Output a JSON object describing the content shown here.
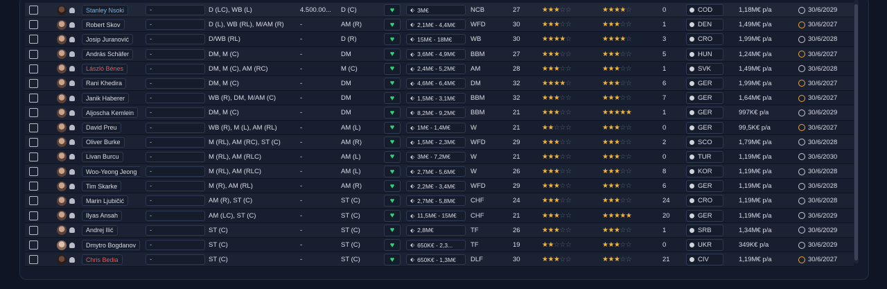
{
  "rows": [
    {
      "name": "Stanley Nsoki",
      "name_style": "link",
      "select": "-",
      "positions": "D (LC), WB (L)",
      "fee": "4.500.00...",
      "role": "D (C)",
      "value": "3M€",
      "rating_pos": "NCB",
      "age": "27",
      "ability_stars": 3,
      "ability_half": false,
      "potential_stars": 3,
      "potential_half": true,
      "count": "0",
      "nation": "COD",
      "wage": "1,18M€ p/a",
      "expiry": "30/6/2029",
      "expiry_warn": false
    },
    {
      "name": "Robert Skov",
      "name_style": "",
      "select": "-",
      "positions": "D (L), WB (RL), M/AM (R)",
      "fee": "-",
      "role": "AM (R)",
      "value": "2,1M€ - 4,4M€",
      "rating_pos": "WFD",
      "age": "30",
      "ability_stars": 2,
      "ability_half": true,
      "potential_stars": 2,
      "potential_half": true,
      "count": "1",
      "nation": "DEN",
      "wage": "1,49M€ p/a",
      "expiry": "30/6/2027",
      "expiry_warn": true
    },
    {
      "name": "Josip Juranović",
      "name_style": "",
      "select": "-",
      "positions": "D/WB (RL)",
      "fee": "-",
      "role": "D (R)",
      "value": "15M€ - 18M€",
      "rating_pos": "WB",
      "age": "30",
      "ability_stars": 3,
      "ability_half": true,
      "potential_stars": 3,
      "potential_half": true,
      "count": "3",
      "nation": "CRO",
      "wage": "1,99M€ p/a",
      "expiry": "30/6/2028",
      "expiry_warn": false
    },
    {
      "name": "András Schäfer",
      "name_style": "",
      "select": "-",
      "positions": "DM, M (C)",
      "fee": "-",
      "role": "DM",
      "value": "3,6M€ - 4,9M€",
      "rating_pos": "BBM",
      "age": "27",
      "ability_stars": 3,
      "ability_half": false,
      "potential_stars": 3,
      "potential_half": false,
      "count": "5",
      "nation": "HUN",
      "wage": "1,24M€ p/a",
      "expiry": "30/6/2027",
      "expiry_warn": true
    },
    {
      "name": "László Bénes",
      "name_style": "red",
      "select": "-",
      "positions": "DM, M (C), AM (RC)",
      "fee": "-",
      "role": "M (C)",
      "value": "2,4M€ - 5,2M€",
      "rating_pos": "AM",
      "age": "28",
      "ability_stars": 3,
      "ability_half": false,
      "potential_stars": 3,
      "potential_half": false,
      "count": "1",
      "nation": "SVK",
      "wage": "1,49M€ p/a",
      "expiry": "30/6/2028",
      "expiry_warn": false
    },
    {
      "name": "Rani Khedira",
      "name_style": "",
      "select": "-",
      "positions": "DM, M (C)",
      "fee": "-",
      "role": "DM",
      "value": "4,6M€ - 6,4M€",
      "rating_pos": "DM",
      "age": "32",
      "ability_stars": 3,
      "ability_half": true,
      "potential_stars": 3,
      "potential_half": false,
      "count": "6",
      "nation": "GER",
      "wage": "1,99M€ p/a",
      "expiry": "30/6/2027",
      "expiry_warn": true
    },
    {
      "name": "Janik Haberer",
      "name_style": "",
      "select": "-",
      "positions": "WB (R), DM, M/AM (C)",
      "fee": "-",
      "role": "DM",
      "value": "1,5M€ - 3,1M€",
      "rating_pos": "BBM",
      "age": "32",
      "ability_stars": 3,
      "ability_half": false,
      "potential_stars": 3,
      "potential_half": false,
      "count": "7",
      "nation": "GER",
      "wage": "1,64M€ p/a",
      "expiry": "30/6/2027",
      "expiry_warn": true
    },
    {
      "name": "Aljoscha Kemlein",
      "name_style": "",
      "select": "-",
      "positions": "DM, M (C)",
      "fee": "-",
      "role": "DM",
      "value": "8,2M€ - 9,2M€",
      "rating_pos": "BBM",
      "age": "21",
      "ability_stars": 2,
      "ability_half": true,
      "potential_stars": 4,
      "potential_half": true,
      "count": "1",
      "nation": "GER",
      "wage": "997K€ p/a",
      "expiry": "30/6/2029",
      "expiry_warn": false
    },
    {
      "name": "David Preu",
      "name_style": "",
      "select": "-",
      "positions": "WB (R), M (L), AM (RL)",
      "fee": "-",
      "role": "AM (L)",
      "value": "1M€ - 1,4M€",
      "rating_pos": "W",
      "age": "21",
      "ability_stars": 2,
      "ability_half": false,
      "potential_stars": 3,
      "potential_half": false,
      "count": "0",
      "nation": "GER",
      "wage": "99,5K€ p/a",
      "expiry": "30/6/2027",
      "expiry_warn": true
    },
    {
      "name": "Oliver Burke",
      "name_style": "",
      "select": "-",
      "positions": "M (RL), AM (RC), ST (C)",
      "fee": "-",
      "role": "AM (R)",
      "value": "1,5M€ - 2,3M€",
      "rating_pos": "WFD",
      "age": "29",
      "ability_stars": 2,
      "ability_half": true,
      "potential_stars": 2,
      "potential_half": true,
      "count": "2",
      "nation": "SCO",
      "wage": "1,79M€ p/a",
      "expiry": "30/6/2028",
      "expiry_warn": false
    },
    {
      "name": "Livan Burcu",
      "name_style": "",
      "select": "-",
      "positions": "M (RL), AM (RLC)",
      "fee": "-",
      "role": "AM (L)",
      "value": "3M€ - 7,2M€",
      "rating_pos": "W",
      "age": "21",
      "ability_stars": 2,
      "ability_half": true,
      "potential_stars": 3,
      "potential_half": false,
      "count": "0",
      "nation": "TUR",
      "wage": "1,19M€ p/a",
      "expiry": "30/6/2030",
      "expiry_warn": false
    },
    {
      "name": "Woo-Yeong Jeong",
      "name_style": "",
      "select": "-",
      "positions": "M (RL), AM (RLC)",
      "fee": "-",
      "role": "AM (L)",
      "value": "2,7M€ - 5,6M€",
      "rating_pos": "W",
      "age": "26",
      "ability_stars": 3,
      "ability_half": false,
      "potential_stars": 3,
      "potential_half": false,
      "count": "8",
      "nation": "KOR",
      "wage": "1,19M€ p/a",
      "expiry": "30/6/2028",
      "expiry_warn": false
    },
    {
      "name": "Tim Skarke",
      "name_style": "",
      "select": "-",
      "positions": "M (R), AM (RL)",
      "fee": "-",
      "role": "AM (R)",
      "value": "2,2M€ - 3,4M€",
      "rating_pos": "WFD",
      "age": "29",
      "ability_stars": 3,
      "ability_half": false,
      "potential_stars": 3,
      "potential_half": false,
      "count": "6",
      "nation": "GER",
      "wage": "1,19M€ p/a",
      "expiry": "30/6/2028",
      "expiry_warn": false
    },
    {
      "name": "Marin Ljubičić",
      "name_style": "",
      "select": "-",
      "positions": "AM (R), ST (C)",
      "fee": "-",
      "role": "ST (C)",
      "value": "2,7M€ - 5,8M€",
      "rating_pos": "CHF",
      "age": "24",
      "ability_stars": 3,
      "ability_half": false,
      "potential_stars": 3,
      "potential_half": false,
      "count": "24",
      "nation": "CRO",
      "wage": "1,19M€ p/a",
      "expiry": "30/6/2028",
      "expiry_warn": false
    },
    {
      "name": "Ilyas Ansah",
      "name_style": "",
      "select": "-",
      "positions": "AM (LC), ST (C)",
      "fee": "-",
      "role": "ST (C)",
      "value": "11,5M€ - 15M€",
      "rating_pos": "CHF",
      "age": "21",
      "ability_stars": 3,
      "ability_half": false,
      "potential_stars": 4,
      "potential_half": true,
      "count": "20",
      "nation": "GER",
      "wage": "1,19M€ p/a",
      "expiry": "30/6/2029",
      "expiry_warn": false
    },
    {
      "name": "Andrej Ilić",
      "name_style": "",
      "select": "-",
      "positions": "ST (C)",
      "fee": "-",
      "role": "ST (C)",
      "value": "2,8M€",
      "rating_pos": "TF",
      "age": "26",
      "ability_stars": 3,
      "ability_half": false,
      "potential_stars": 3,
      "potential_half": false,
      "count": "1",
      "nation": "SRB",
      "wage": "1,34M€ p/a",
      "expiry": "30/6/2029",
      "expiry_warn": false
    },
    {
      "name": "Dmytro Bogdanov",
      "name_style": "",
      "select": "-",
      "positions": "ST (C)",
      "fee": "-",
      "role": "ST (C)",
      "value": "650K€ - 2,3...",
      "rating_pos": "TF",
      "age": "19",
      "ability_stars": 2,
      "ability_half": false,
      "potential_stars": 3,
      "potential_half": false,
      "count": "0",
      "nation": "UKR",
      "wage": "349K€ p/a",
      "expiry": "30/6/2029",
      "expiry_warn": false
    },
    {
      "name": "Chris Bedia",
      "name_style": "red",
      "select": "-",
      "positions": "ST (C)",
      "fee": "-",
      "role": "ST (C)",
      "value": "650K€ - 1,3M€",
      "rating_pos": "DLF",
      "age": "30",
      "ability_stars": 2,
      "ability_half": true,
      "potential_stars": 2,
      "potential_half": true,
      "count": "21",
      "nation": "CIV",
      "wage": "1,19M€ p/a",
      "expiry": "30/6/2027",
      "expiry_warn": true
    }
  ],
  "icons": {
    "heart": "♥",
    "star_full": "★",
    "star_empty": "☆",
    "tag": "🏷"
  },
  "colors": {
    "star": "#f2b53a",
    "heart": "#35d07a",
    "link_name": "#6fb7e8",
    "red_name": "#e35a5a",
    "expiry_warn": "#f2a52a"
  }
}
